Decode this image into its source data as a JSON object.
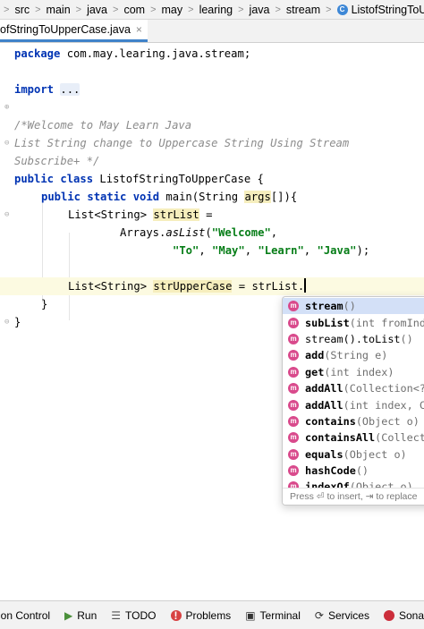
{
  "breadcrumb": {
    "items": [
      "src",
      "main",
      "java",
      "com",
      "may",
      "learing",
      "java",
      "stream"
    ],
    "current": "ListofStringToUpperCase",
    "current_icon": "class-icon"
  },
  "tab": {
    "label": "ofStringToUpperCase.java",
    "close": "×"
  },
  "code": {
    "l1_kw": "package",
    "l1_rest": " com.may.learing.java.stream;",
    "l2_kw": "import",
    "l2_fold": "...",
    "l3": "/*Welcome to May Learn Java",
    "l4": "List String change to Uppercase String Using Stream",
    "l5": "Subscribe+ */",
    "l6_kw": "public class",
    "l6_rest": " ListofStringToUpperCase {",
    "l7_kw": "public static void",
    "l7_a": " main(String ",
    "l7_b": "args",
    "l7_c": "[]){",
    "l8_a": "List<String> ",
    "l8_b": "strList",
    "l8_c": " =",
    "l9_a": "Arrays.",
    "l9_b": "asList",
    "l9_c": "(",
    "l9_d": "\"Welcome\"",
    "l9_e": ",",
    "l10_a": "\"To\"",
    "l10_b": ", ",
    "l10_c": "\"May\"",
    "l10_d": ", ",
    "l10_e": "\"Learn\"",
    "l10_f": ", ",
    "l10_g": "\"Java\"",
    "l10_h": ");",
    "l11_a": "List<String> ",
    "l11_b": "strUpperCase",
    "l11_c": " = strList.",
    "l12": "}",
    "l13": "}"
  },
  "completion": {
    "items": [
      {
        "name": "stream",
        "sig": "()"
      },
      {
        "name": "subList",
        "sig": "(int fromIndex, int toIndex)"
      },
      {
        "name": "stream().toList",
        "sig": "()"
      },
      {
        "name": "add",
        "sig": "(String e)"
      },
      {
        "name": "get",
        "sig": "(int index)"
      },
      {
        "name": "addAll",
        "sig": "(Collection<? extends String> c)"
      },
      {
        "name": "addAll",
        "sig": "(int index, Collection<? extends String> c)"
      },
      {
        "name": "contains",
        "sig": "(Object o)"
      },
      {
        "name": "containsAll",
        "sig": "(Collection<?> c)"
      },
      {
        "name": "equals",
        "sig": "(Object o)"
      },
      {
        "name": "hashCode",
        "sig": "()"
      },
      {
        "name": "indexOf",
        "sig": "(Object o)"
      }
    ],
    "badge": "m",
    "footer": "Press ⏎ to insert, ⇥ to replace"
  },
  "tools": [
    {
      "label": "sion Control",
      "icon": ""
    },
    {
      "label": "Run",
      "icon": "▶"
    },
    {
      "label": "TODO",
      "icon": "☰"
    },
    {
      "label": "Problems",
      "icon": "!"
    },
    {
      "label": "Terminal",
      "icon": "▣"
    },
    {
      "label": "Services",
      "icon": "⟳"
    },
    {
      "label": "SonarL",
      "icon": ""
    }
  ]
}
